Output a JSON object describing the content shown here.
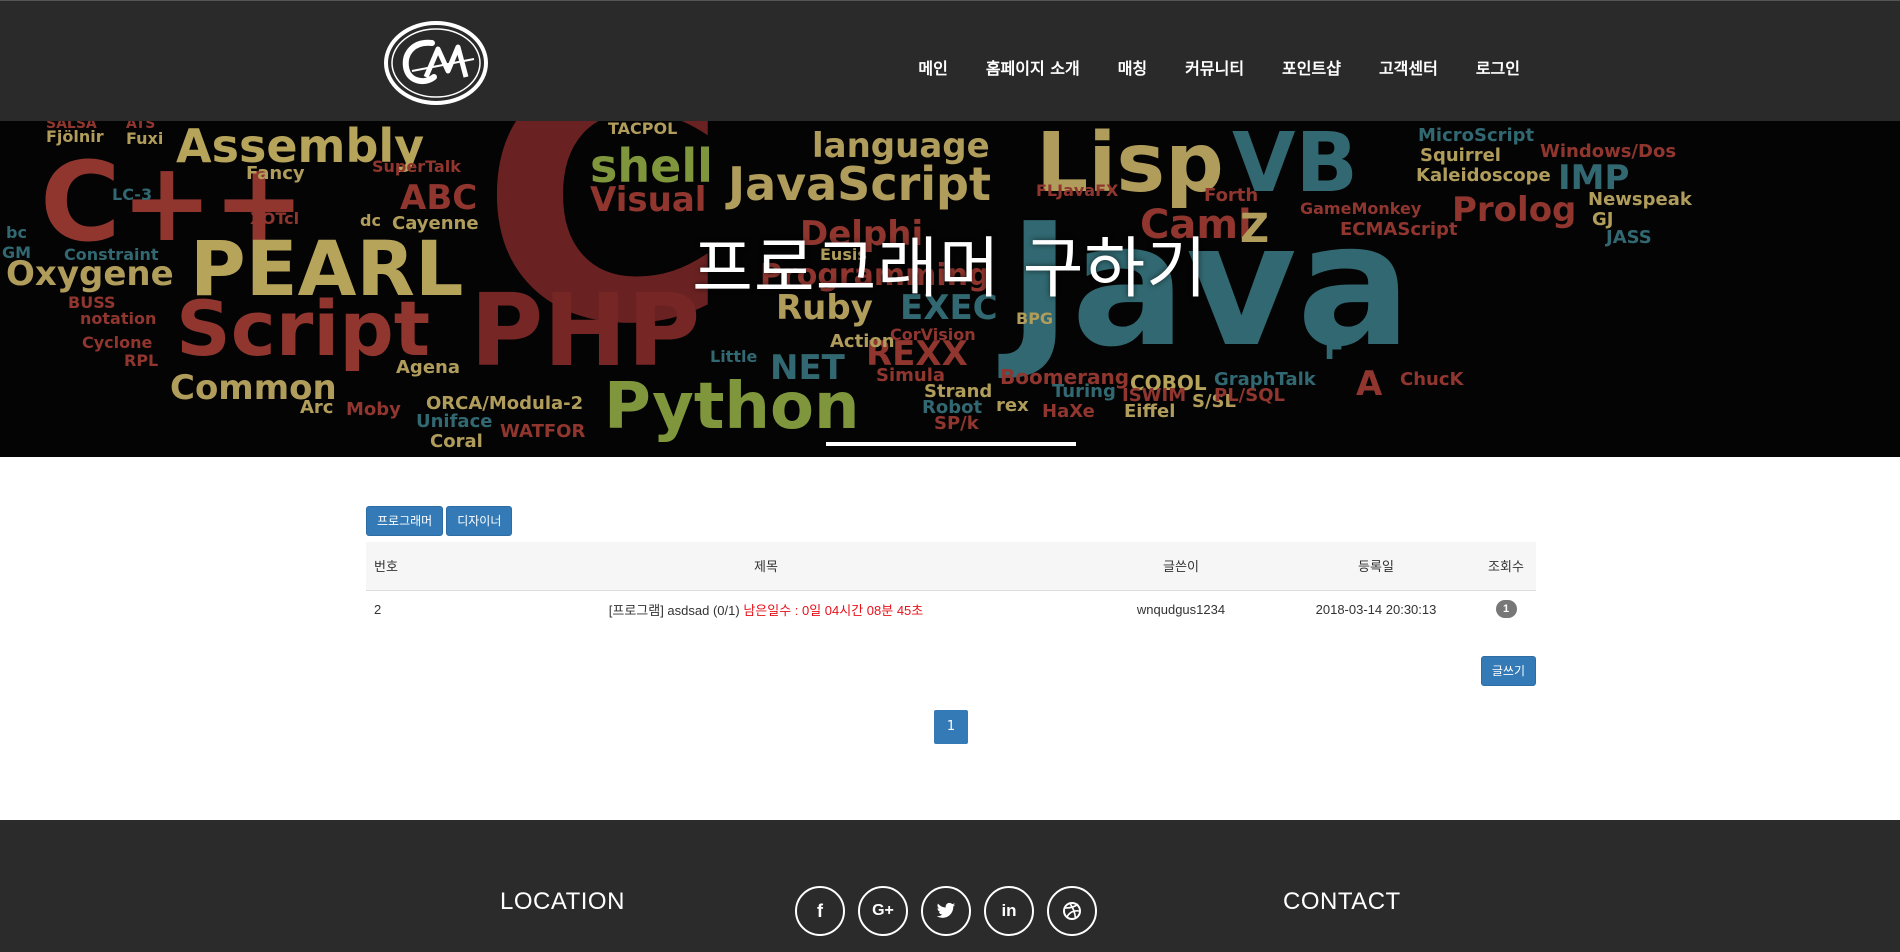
{
  "logo": {
    "text": "CM"
  },
  "nav": {
    "items": [
      "메인",
      "홈페이지 소개",
      "매칭",
      "커뮤니티",
      "포인트샵",
      "고객센터",
      "로그인"
    ]
  },
  "hero": {
    "title": "프로그래머 구하기",
    "background_words": [
      "Assembly",
      "C++",
      "shell",
      "language",
      "Lisp",
      "VB",
      "JavaScript",
      "IMP",
      "Prolog",
      "PEARL",
      "Oxygene",
      "Script",
      "PHP",
      "Java",
      "Ruby",
      "EXEC",
      "REXX",
      "NET",
      "Common",
      "Python",
      "COBOL",
      "Boomerang",
      "ABC",
      "Cayenne",
      "Fancy",
      "Visual",
      "Delphi",
      "Programming",
      "Caml",
      "Z",
      "ECMAScript",
      "GameMonkey",
      "Newspeak",
      "Squirrel",
      "Kaleidoscope",
      "MicroScript",
      "Windows/Dos",
      "GJ",
      "JASS",
      "ORCA/Modula-2",
      "Uniface",
      "Coral",
      "WATFOR",
      "Agena",
      "Arc",
      "Moby",
      "Strand",
      "Turing",
      "rex",
      "HaXe",
      "Eiffel",
      "ISWIM",
      "S/SL",
      "PL/SQL",
      "GraphTalk",
      "ChucK",
      "A",
      "F",
      "Forth",
      "FLJavaFX",
      "Action",
      "CorVision",
      "Little",
      "Robot",
      "SP/k",
      "Simula",
      "BPG",
      "Fjölnir",
      "Fuxi",
      "SALSA",
      "ATS",
      "LC-3",
      "XOTcl",
      "dc",
      "Constraint",
      "BUSS",
      "notation",
      "Cyclone",
      "RPL",
      "TACPOL",
      "SuperTalk",
      "bc",
      "GM",
      "Eusis"
    ]
  },
  "board": {
    "categories": [
      "프로그래머",
      "디자이너"
    ],
    "columns": [
      "번호",
      "제목",
      "글쓴이",
      "등록일",
      "조회수"
    ],
    "rows": [
      {
        "no": "2",
        "title": "[프로그램] asdsad (0/1)",
        "remaining": "남은일수 : 0일 04시간 08분 45초",
        "writer": "wnqudgus1234",
        "date": "2018-03-14 20:30:13",
        "views": "1"
      }
    ],
    "write_label": "글쓰기",
    "current_page": "1"
  },
  "footer": {
    "location_label": "LOCATION",
    "contact_label": "CONTACT",
    "social_icons": [
      "facebook-icon",
      "google-plus-icon",
      "twitter-icon",
      "linkedin-icon",
      "dribbble-icon"
    ]
  },
  "colors": {
    "navbar": "#2a2a2b",
    "footer": "#2b2b2c",
    "primary_button": "#337ab7",
    "remaining_time": "#e8101a",
    "badge": "#777777"
  }
}
